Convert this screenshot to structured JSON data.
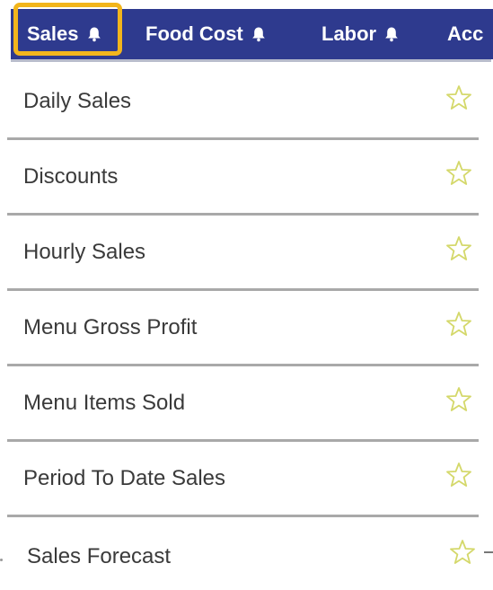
{
  "nav": {
    "tabs": [
      {
        "label": "Sales",
        "icon": "bell-icon"
      },
      {
        "label": "Food Cost",
        "icon": "bell-icon"
      },
      {
        "label": "Labor",
        "icon": "bell-icon"
      },
      {
        "label": "Acc"
      }
    ],
    "active_tab": "Sales",
    "colors": {
      "bar": "#2e3a8e",
      "highlight": "#f2b51c",
      "text": "#ffffff"
    }
  },
  "menu": {
    "items": [
      {
        "label": "Daily Sales",
        "icon": "star-outline-icon"
      },
      {
        "label": "Discounts",
        "icon": "star-outline-icon"
      },
      {
        "label": "Hourly Sales",
        "icon": "star-outline-icon"
      },
      {
        "label": "Menu Gross Profit",
        "icon": "star-outline-icon"
      },
      {
        "label": "Menu Items Sold",
        "icon": "star-outline-icon"
      },
      {
        "label": "Period To Date Sales",
        "icon": "star-outline-icon"
      },
      {
        "label": "Sales Forecast",
        "icon": "star-outline-icon"
      }
    ],
    "colors": {
      "text": "#3a3a3a",
      "star": "#d4d86a",
      "divider": "#a9a9a9"
    }
  }
}
